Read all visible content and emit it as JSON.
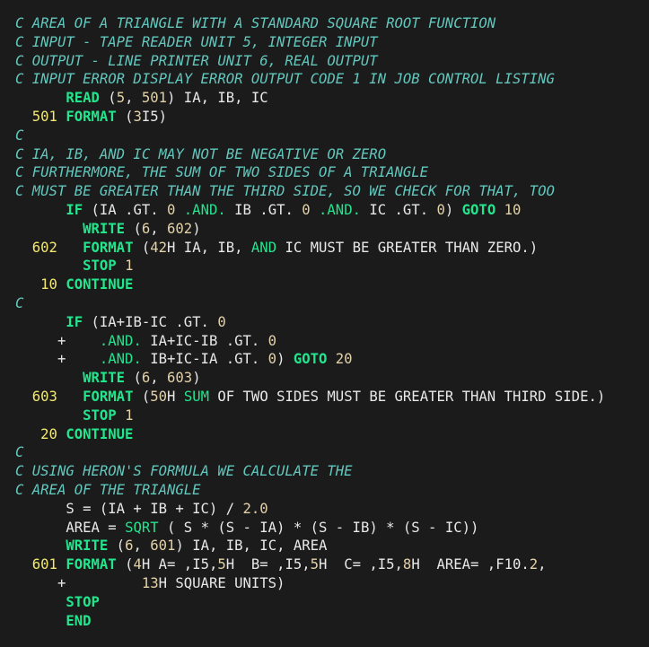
{
  "lines": [
    [
      {
        "t": "C AREA OF A TRIANGLE WITH A STANDARD SQUARE ROOT FUNCTION",
        "c": "cm"
      }
    ],
    [
      {
        "t": "C INPUT - TAPE READER UNIT 5, INTEGER INPUT",
        "c": "cm"
      }
    ],
    [
      {
        "t": "C OUTPUT - LINE PRINTER UNIT 6, REAL OUTPUT",
        "c": "cm"
      }
    ],
    [
      {
        "t": "C INPUT ERROR DISPLAY ERROR OUTPUT CODE 1 IN JOB CONTROL LISTING",
        "c": "cm"
      }
    ],
    [
      {
        "t": "      ",
        "c": "id"
      },
      {
        "t": "READ",
        "c": "kw"
      },
      {
        "t": " (",
        "c": "id"
      },
      {
        "t": "5",
        "c": "num"
      },
      {
        "t": ", ",
        "c": "id"
      },
      {
        "t": "501",
        "c": "num"
      },
      {
        "t": ") IA, IB, IC",
        "c": "id"
      }
    ],
    [
      {
        "t": "  ",
        "c": "id"
      },
      {
        "t": "501",
        "c": "lbl"
      },
      {
        "t": " ",
        "c": "id"
      },
      {
        "t": "FORMAT",
        "c": "kw"
      },
      {
        "t": " (",
        "c": "id"
      },
      {
        "t": "3",
        "c": "num"
      },
      {
        "t": "I5)",
        "c": "id"
      }
    ],
    [
      {
        "t": "C",
        "c": "cm"
      }
    ],
    [
      {
        "t": "C IA, IB, AND IC MAY NOT BE NEGATIVE OR ZERO",
        "c": "cm"
      }
    ],
    [
      {
        "t": "C FURTHERMORE, THE SUM OF TWO SIDES OF A TRIANGLE",
        "c": "cm"
      }
    ],
    [
      {
        "t": "C MUST BE GREATER THAN THE THIRD SIDE, SO WE CHECK FOR THAT, TOO",
        "c": "cm"
      }
    ],
    [
      {
        "t": "      ",
        "c": "id"
      },
      {
        "t": "IF",
        "c": "kw"
      },
      {
        "t": " (IA .GT. ",
        "c": "id"
      },
      {
        "t": "0",
        "c": "num"
      },
      {
        "t": " ",
        "c": "id"
      },
      {
        "t": ".AND.",
        "c": "fn"
      },
      {
        "t": " IB .GT. ",
        "c": "id"
      },
      {
        "t": "0",
        "c": "num"
      },
      {
        "t": " ",
        "c": "id"
      },
      {
        "t": ".AND.",
        "c": "fn"
      },
      {
        "t": " IC .GT. ",
        "c": "id"
      },
      {
        "t": "0",
        "c": "num"
      },
      {
        "t": ") ",
        "c": "id"
      },
      {
        "t": "GOTO",
        "c": "kw"
      },
      {
        "t": " ",
        "c": "id"
      },
      {
        "t": "10",
        "c": "num"
      }
    ],
    [
      {
        "t": "        ",
        "c": "id"
      },
      {
        "t": "WRITE",
        "c": "kw"
      },
      {
        "t": " (",
        "c": "id"
      },
      {
        "t": "6",
        "c": "num"
      },
      {
        "t": ", ",
        "c": "id"
      },
      {
        "t": "602",
        "c": "num"
      },
      {
        "t": ")",
        "c": "id"
      }
    ],
    [
      {
        "t": "  ",
        "c": "id"
      },
      {
        "t": "602",
        "c": "lbl"
      },
      {
        "t": "   ",
        "c": "id"
      },
      {
        "t": "FORMAT",
        "c": "kw"
      },
      {
        "t": " (",
        "c": "id"
      },
      {
        "t": "42",
        "c": "num"
      },
      {
        "t": "H IA, IB, ",
        "c": "id"
      },
      {
        "t": "AND",
        "c": "fn"
      },
      {
        "t": " IC MUST BE GREATER THAN ZERO.)",
        "c": "id"
      }
    ],
    [
      {
        "t": "        ",
        "c": "id"
      },
      {
        "t": "STOP",
        "c": "kw"
      },
      {
        "t": " ",
        "c": "id"
      },
      {
        "t": "1",
        "c": "num"
      }
    ],
    [
      {
        "t": "   ",
        "c": "id"
      },
      {
        "t": "10",
        "c": "lbl"
      },
      {
        "t": " ",
        "c": "id"
      },
      {
        "t": "CONTINUE",
        "c": "kw"
      }
    ],
    [
      {
        "t": "C",
        "c": "cm"
      }
    ],
    [
      {
        "t": "      ",
        "c": "id"
      },
      {
        "t": "IF",
        "c": "kw"
      },
      {
        "t": " (IA+IB-IC .GT. ",
        "c": "id"
      },
      {
        "t": "0",
        "c": "num"
      }
    ],
    [
      {
        "t": "     +    ",
        "c": "id"
      },
      {
        "t": ".AND.",
        "c": "fn"
      },
      {
        "t": " IA+IC-IB .GT. ",
        "c": "id"
      },
      {
        "t": "0",
        "c": "num"
      }
    ],
    [
      {
        "t": "     +    ",
        "c": "id"
      },
      {
        "t": ".AND.",
        "c": "fn"
      },
      {
        "t": " IB+IC-IA .GT. ",
        "c": "id"
      },
      {
        "t": "0",
        "c": "num"
      },
      {
        "t": ") ",
        "c": "id"
      },
      {
        "t": "GOTO",
        "c": "kw"
      },
      {
        "t": " ",
        "c": "id"
      },
      {
        "t": "20",
        "c": "num"
      }
    ],
    [
      {
        "t": "        ",
        "c": "id"
      },
      {
        "t": "WRITE",
        "c": "kw"
      },
      {
        "t": " (",
        "c": "id"
      },
      {
        "t": "6",
        "c": "num"
      },
      {
        "t": ", ",
        "c": "id"
      },
      {
        "t": "603",
        "c": "num"
      },
      {
        "t": ")",
        "c": "id"
      }
    ],
    [
      {
        "t": "  ",
        "c": "id"
      },
      {
        "t": "603",
        "c": "lbl"
      },
      {
        "t": "   ",
        "c": "id"
      },
      {
        "t": "FORMAT",
        "c": "kw"
      },
      {
        "t": " (",
        "c": "id"
      },
      {
        "t": "50",
        "c": "num"
      },
      {
        "t": "H ",
        "c": "id"
      },
      {
        "t": "SUM",
        "c": "fn"
      },
      {
        "t": " OF TWO SIDES MUST BE GREATER THAN THIRD SIDE.)",
        "c": "id"
      }
    ],
    [
      {
        "t": "        ",
        "c": "id"
      },
      {
        "t": "STOP",
        "c": "kw"
      },
      {
        "t": " ",
        "c": "id"
      },
      {
        "t": "1",
        "c": "num"
      }
    ],
    [
      {
        "t": "   ",
        "c": "id"
      },
      {
        "t": "20",
        "c": "lbl"
      },
      {
        "t": " ",
        "c": "id"
      },
      {
        "t": "CONTINUE",
        "c": "kw"
      }
    ],
    [
      {
        "t": "C",
        "c": "cm"
      }
    ],
    [
      {
        "t": "C USING HERON'S FORMULA WE CALCULATE THE",
        "c": "cm"
      }
    ],
    [
      {
        "t": "C AREA OF THE TRIANGLE",
        "c": "cm"
      }
    ],
    [
      {
        "t": "      S = (IA + IB + IC) / ",
        "c": "id"
      },
      {
        "t": "2.0",
        "c": "num"
      }
    ],
    [
      {
        "t": "      AREA = ",
        "c": "id"
      },
      {
        "t": "SQRT",
        "c": "fn"
      },
      {
        "t": " ( S * (S - IA) * (S - IB) * (S - IC))",
        "c": "id"
      }
    ],
    [
      {
        "t": "      ",
        "c": "id"
      },
      {
        "t": "WRITE",
        "c": "kw"
      },
      {
        "t": " (",
        "c": "id"
      },
      {
        "t": "6",
        "c": "num"
      },
      {
        "t": ", ",
        "c": "id"
      },
      {
        "t": "601",
        "c": "num"
      },
      {
        "t": ") IA, IB, IC, AREA",
        "c": "id"
      }
    ],
    [
      {
        "t": "  ",
        "c": "id"
      },
      {
        "t": "601",
        "c": "lbl"
      },
      {
        "t": " ",
        "c": "id"
      },
      {
        "t": "FORMAT",
        "c": "kw"
      },
      {
        "t": " (",
        "c": "id"
      },
      {
        "t": "4",
        "c": "num"
      },
      {
        "t": "H A= ,I5,",
        "c": "id"
      },
      {
        "t": "5",
        "c": "num"
      },
      {
        "t": "H  B= ,I5,",
        "c": "id"
      },
      {
        "t": "5",
        "c": "num"
      },
      {
        "t": "H  C= ,I5,",
        "c": "id"
      },
      {
        "t": "8",
        "c": "num"
      },
      {
        "t": "H  AREA= ,F10.",
        "c": "id"
      },
      {
        "t": "2",
        "c": "num"
      },
      {
        "t": ",",
        "c": "id"
      }
    ],
    [
      {
        "t": "     +         ",
        "c": "id"
      },
      {
        "t": "13",
        "c": "num"
      },
      {
        "t": "H SQUARE UNITS)",
        "c": "id"
      }
    ],
    [
      {
        "t": "      ",
        "c": "id"
      },
      {
        "t": "STOP",
        "c": "kw"
      }
    ],
    [
      {
        "t": "      ",
        "c": "id"
      },
      {
        "t": "END",
        "c": "kw"
      }
    ]
  ]
}
